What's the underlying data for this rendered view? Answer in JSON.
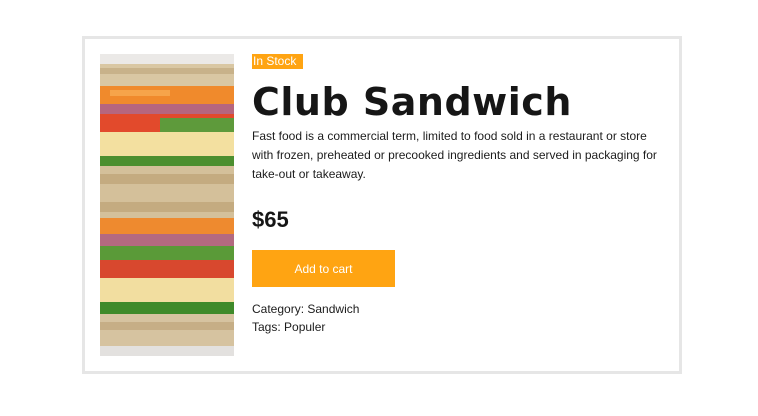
{
  "product": {
    "stock_badge": "In Stock",
    "title": "Club Sandwich",
    "description": "Fast food is a commercial term, limited to food sold in a restaurant or store with frozen, preheated or precooked ingredients and served in packaging for take-out or takeaway.",
    "price": "$65",
    "add_to_cart_label": "Add to cart",
    "category_label": "Category:",
    "category_value": "Sandwich",
    "tags_label": "Tags:",
    "tags_value": "Populer",
    "image_subject": "club-sandwich-photo"
  },
  "colors": {
    "accent": "#ffa412",
    "card_border": "#e6e6e6",
    "text": "#161616"
  }
}
